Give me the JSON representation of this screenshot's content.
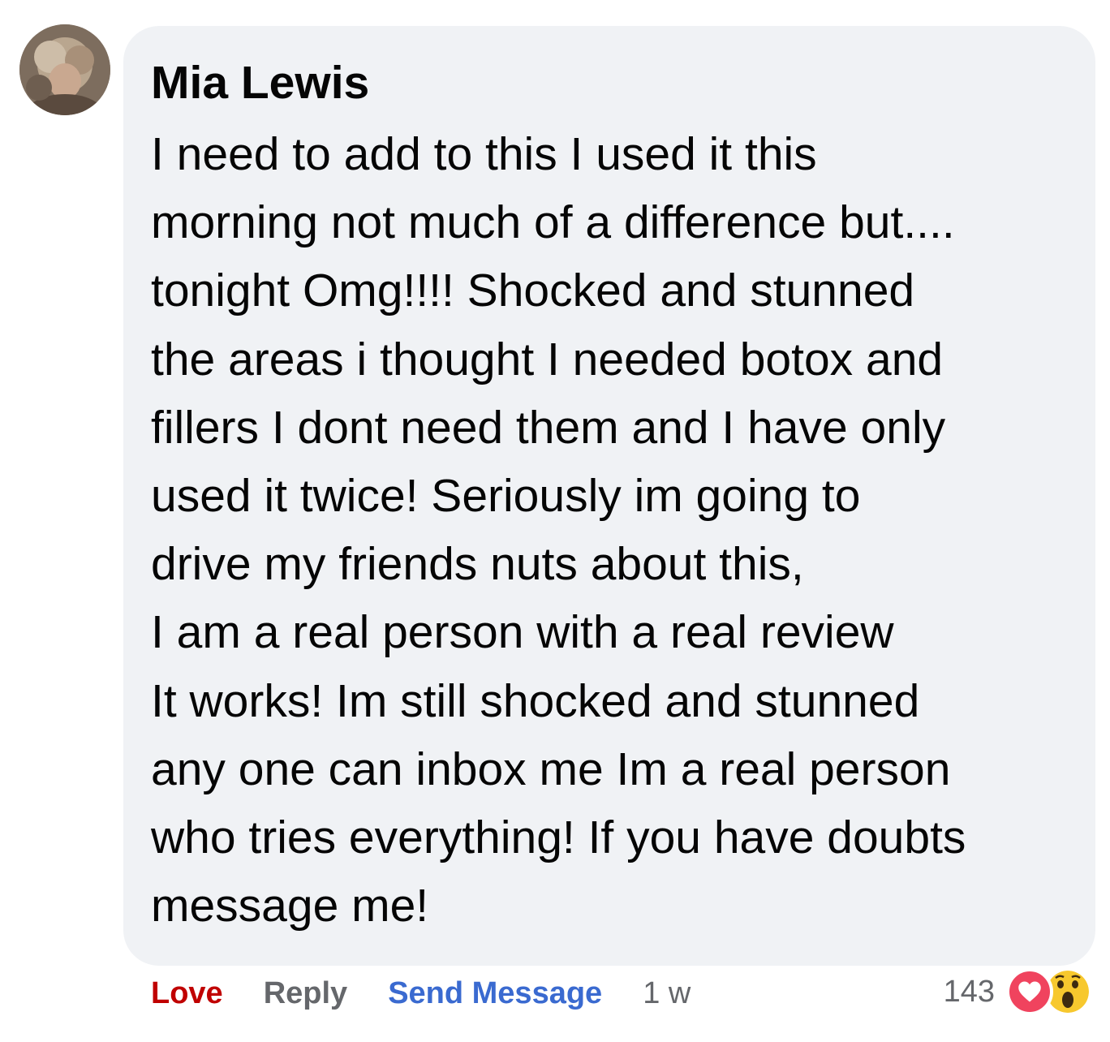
{
  "comment": {
    "author": "Mia Lewis",
    "lines": [
      "I need to add to this I used it this",
      "morning not much of a difference but....",
      "tonight Omg!!!! Shocked and stunned",
      "the areas i thought I needed botox and",
      "fillers I dont need them and I have only",
      "used it twice! Seriously im going to",
      "drive my friends nuts about this,",
      "I am a real person with a real review",
      "It works! Im still shocked and stunned",
      "any one can inbox me Im a real person",
      "who tries everything! If you have doubts",
      "message me!"
    ]
  },
  "actions": {
    "love_label": "Love",
    "reply_label": "Reply",
    "send_message_label": "Send Message",
    "timestamp": "1 w"
  },
  "reactions": {
    "count": "143",
    "icons": [
      "love-reaction-icon",
      "wow-reaction-icon"
    ]
  },
  "colors": {
    "bubble": "#f0f2f5",
    "love": "#c00000",
    "send_message": "#3a6ad0",
    "muted": "#65676b"
  }
}
